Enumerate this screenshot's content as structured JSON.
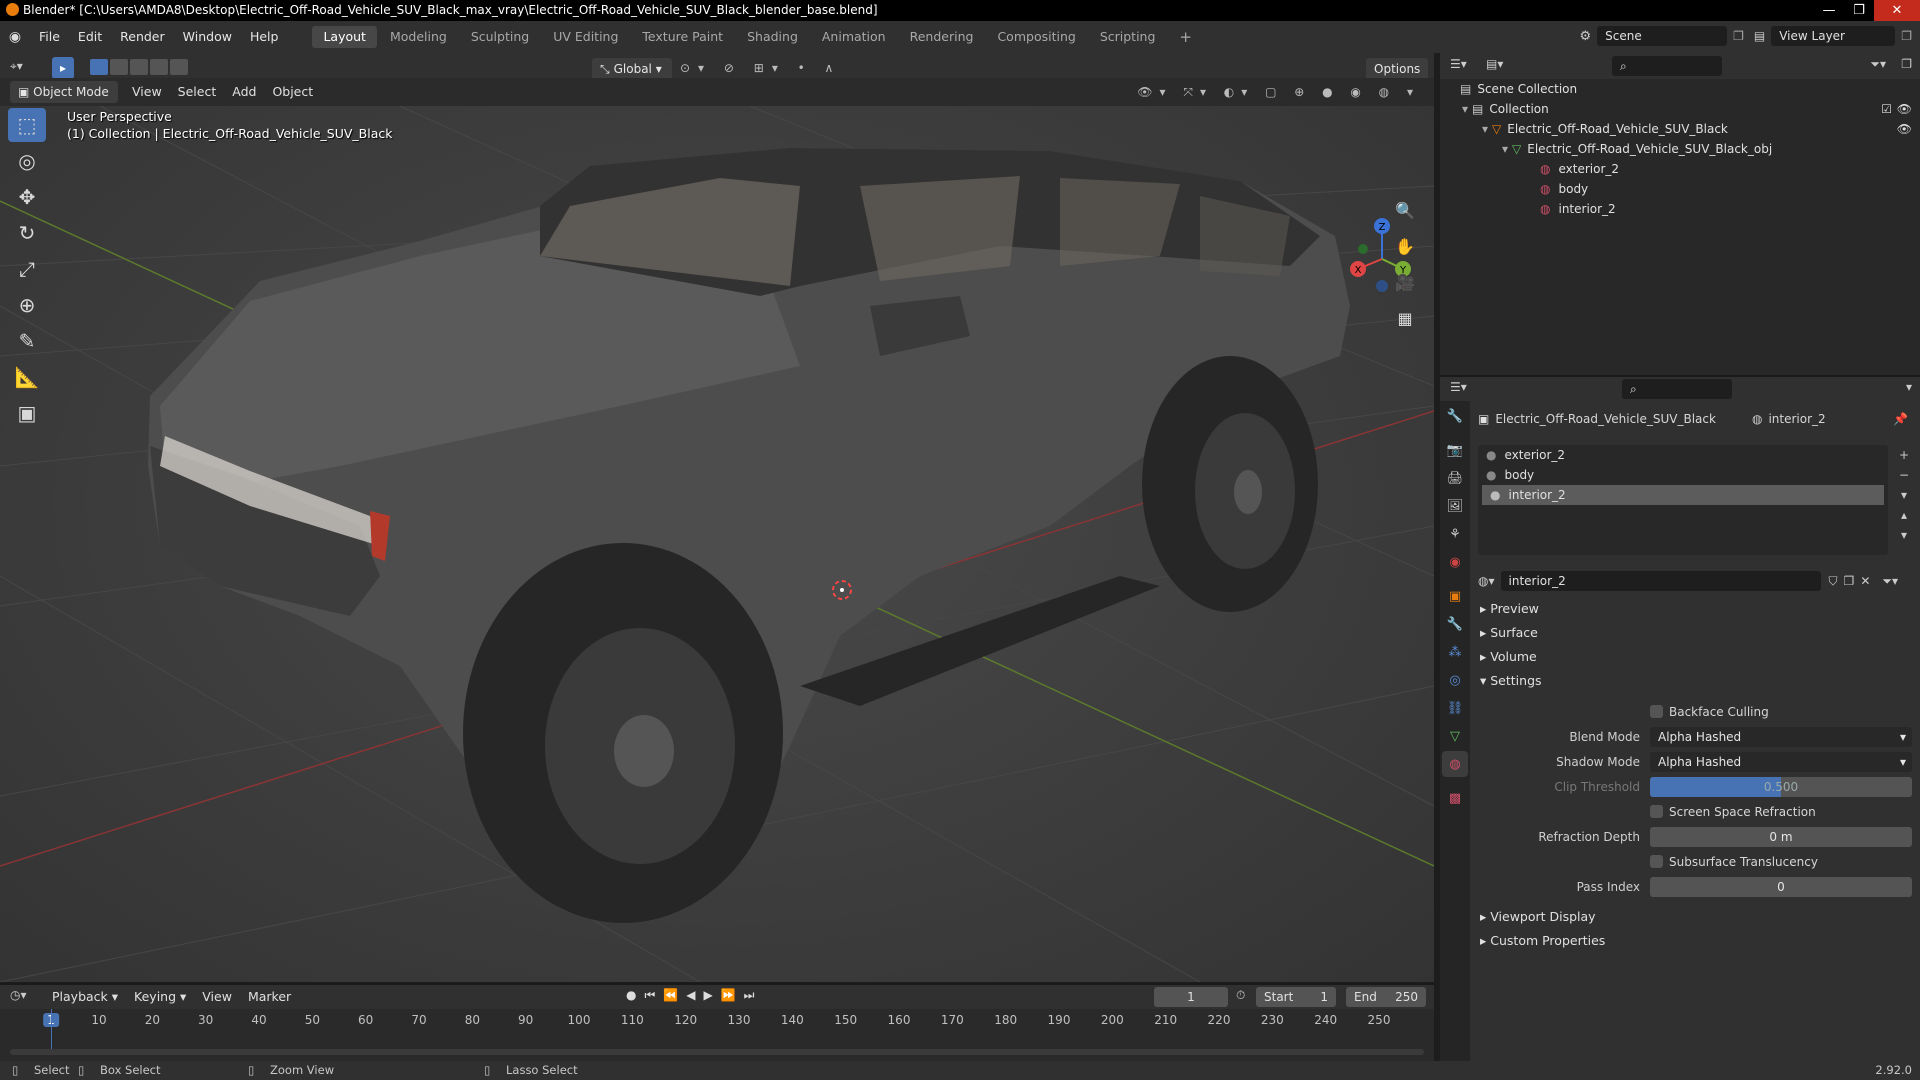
{
  "window": {
    "title": "Blender* [C:\\Users\\AMDA8\\Desktop\\Electric_Off-Road_Vehicle_SUV_Black_max_vray\\Electric_Off-Road_Vehicle_SUV_Black_blender_base.blend]",
    "minimize": "—",
    "maximize": "❐",
    "close": "✕"
  },
  "menu": {
    "items": [
      "File",
      "Edit",
      "Render",
      "Window",
      "Help"
    ],
    "workspaces": [
      "Layout",
      "Modeling",
      "Sculpting",
      "UV Editing",
      "Texture Paint",
      "Shading",
      "Animation",
      "Rendering",
      "Compositing",
      "Scripting"
    ],
    "active_workspace": "Layout",
    "add_workspace": "+",
    "scene": "Scene",
    "view_layer": "View Layer"
  },
  "viewport_header": {
    "transform_orientation": "Global",
    "options": "Options",
    "mode": "Object Mode",
    "menus": [
      "View",
      "Select",
      "Add",
      "Object"
    ]
  },
  "viewport": {
    "perspective": "User Perspective",
    "collection_info": "(1) Collection | Electric_Off-Road_Vehicle_SUV_Black",
    "gizmo": {
      "z": "Z",
      "x": "X",
      "y": "Y"
    }
  },
  "outliner": {
    "root": "Scene Collection",
    "rows": [
      {
        "label": "Collection",
        "depth": 1
      },
      {
        "label": "Electric_Off-Road_Vehicle_SUV_Black",
        "depth": 2
      },
      {
        "label": "Electric_Off-Road_Vehicle_SUV_Black_obj",
        "depth": 3
      },
      {
        "label": "exterior_2",
        "depth": 4
      },
      {
        "label": "body",
        "depth": 4
      },
      {
        "label": "interior_2",
        "depth": 4
      }
    ]
  },
  "properties": {
    "breadcrumb_object": "Electric_Off-Road_Vehicle_SUV_Black",
    "breadcrumb_material": "interior_2",
    "material_slots": [
      "exterior_2",
      "body",
      "interior_2"
    ],
    "active_slot": "interior_2",
    "material_name": "interior_2",
    "panels": {
      "preview": "Preview",
      "surface": "Surface",
      "volume": "Volume",
      "settings": "Settings",
      "viewport_display": "Viewport Display",
      "custom_properties": "Custom Properties"
    },
    "settings": {
      "backface_culling": "Backface Culling",
      "blend_mode_label": "Blend Mode",
      "blend_mode": "Alpha Hashed",
      "shadow_mode_label": "Shadow Mode",
      "shadow_mode": "Alpha Hashed",
      "clip_threshold_label": "Clip Threshold",
      "clip_threshold": "0.500",
      "ssr": "Screen Space Refraction",
      "refraction_depth_label": "Refraction Depth",
      "refraction_depth": "0 m",
      "subsurface": "Subsurface Translucency",
      "pass_index_label": "Pass Index",
      "pass_index": "0"
    }
  },
  "timeline": {
    "menus": [
      "Playback",
      "Keying",
      "View",
      "Marker"
    ],
    "current_frame": "1",
    "start_label": "Start",
    "start": "1",
    "end_label": "End",
    "end": "250",
    "ticks": [
      "1",
      "10",
      "20",
      "30",
      "40",
      "50",
      "60",
      "70",
      "80",
      "90",
      "100",
      "110",
      "120",
      "130",
      "140",
      "150",
      "160",
      "170",
      "180",
      "190",
      "200",
      "210",
      "220",
      "230",
      "240",
      "250"
    ]
  },
  "statusbar": {
    "select": "Select",
    "box_select": "Box Select",
    "zoom_view": "Zoom View",
    "lasso_select": "Lasso Select",
    "version": "2.92.0"
  },
  "colors": {
    "accent": "#4772b3",
    "active_tab": "#474747",
    "object_orange": "#e87d0d"
  }
}
